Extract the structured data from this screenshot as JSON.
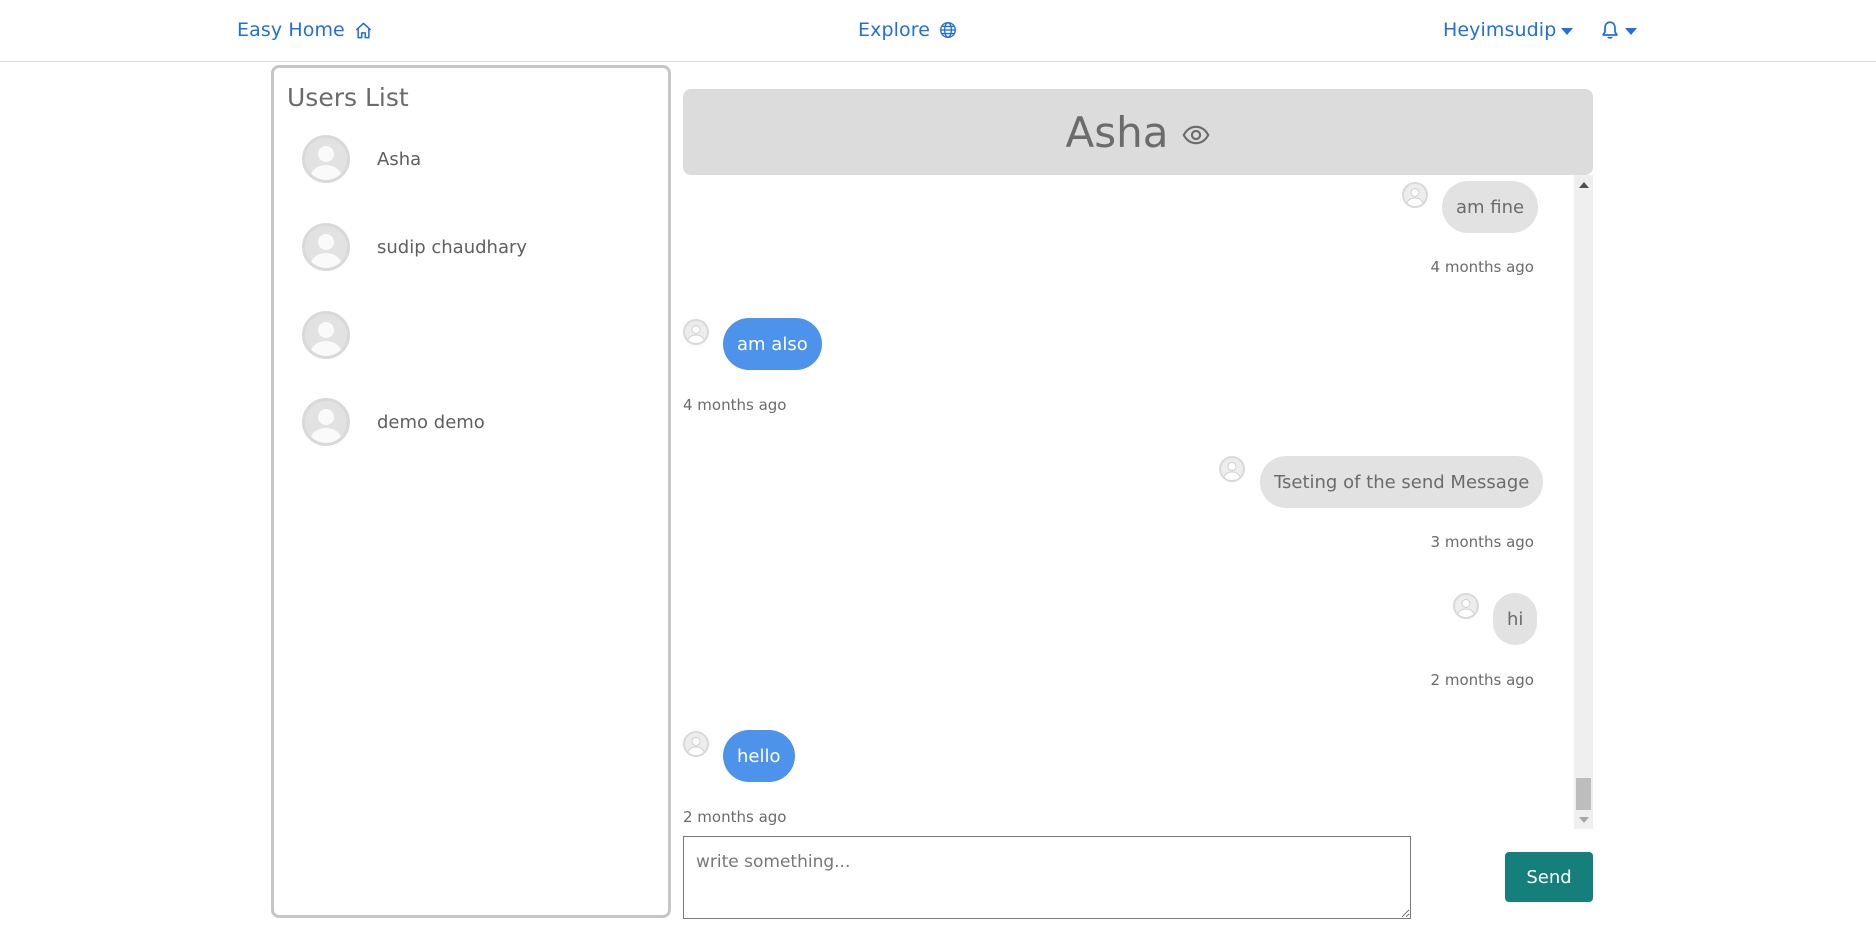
{
  "nav": {
    "home_label": "Easy Home",
    "explore_label": "Explore",
    "user_label": "Heyimsudip",
    "brand_color": "#1f6fe0"
  },
  "users_panel": {
    "title": "Users List",
    "users": [
      {
        "name": "Asha"
      },
      {
        "name": "sudip chaudhary"
      },
      {
        "name": ""
      },
      {
        "name": "demo demo"
      }
    ]
  },
  "chat": {
    "title": "Asha",
    "messages": [
      {
        "text": "am fine",
        "time": "4 months ago",
        "side": "mine"
      },
      {
        "text": "am also",
        "time": "4 months ago",
        "side": "theirs"
      },
      {
        "text": "Tseting of the send Message",
        "time": "3 months ago",
        "side": "mine"
      },
      {
        "text": "hi",
        "time": "2 months ago",
        "side": "mine"
      },
      {
        "text": "hello",
        "time": "2 months ago",
        "side": "theirs"
      }
    ],
    "colors": {
      "mine_bubble": "#e2e2e2",
      "theirs_bubble": "#4d93ec"
    }
  },
  "composer": {
    "placeholder": "write something...",
    "value": "",
    "send_label": "Send",
    "send_color": "#147f7b"
  }
}
